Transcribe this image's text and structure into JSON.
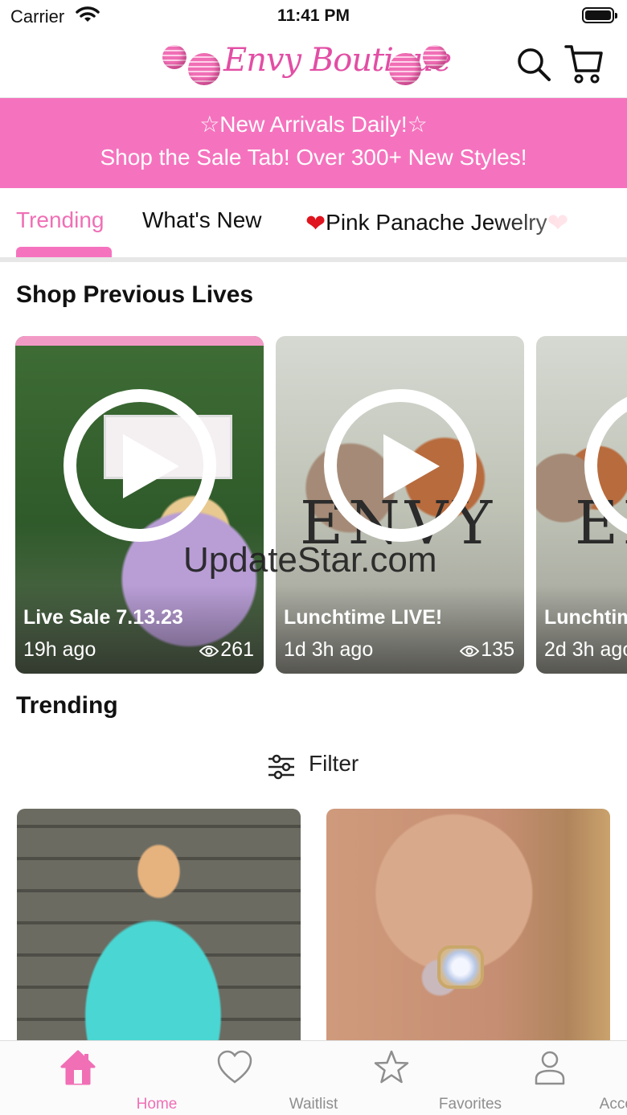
{
  "status_bar": {
    "carrier": "Carrier",
    "time": "11:41 PM"
  },
  "header": {
    "logo_text": "Envy Boutique"
  },
  "banner": {
    "line1": "☆New Arrivals Daily!☆",
    "line2": "Shop the Sale Tab! Over 300+ New Styles!",
    "color": "#f573be"
  },
  "tabs": [
    {
      "label": "Trending",
      "active": true
    },
    {
      "label": "What's New"
    },
    {
      "label": "Pink Panache Jewelry"
    }
  ],
  "previous_lives": {
    "title": "Shop Previous Lives",
    "items": [
      {
        "title": "Live Sale 7.13.23",
        "time": "19h ago",
        "views": "261"
      },
      {
        "title": "Lunchtime LIVE!",
        "time": "1d 3h ago",
        "views": "135"
      },
      {
        "title": "Lunchtime LIVE!",
        "time": "2d 3h ago"
      }
    ]
  },
  "watermark": "UpdateStar.com",
  "trending": {
    "title": "Trending",
    "filter_label": "Filter"
  },
  "bottom_nav": [
    {
      "label": "Home",
      "icon": "home-icon",
      "active": true
    },
    {
      "label": "Waitlist",
      "icon": "heart-icon"
    },
    {
      "label": "Favorites",
      "icon": "star-icon"
    },
    {
      "label": "Account",
      "icon": "person-icon"
    }
  ],
  "colors": {
    "accent": "#f06fb5",
    "inactive": "#8e8e8e"
  }
}
